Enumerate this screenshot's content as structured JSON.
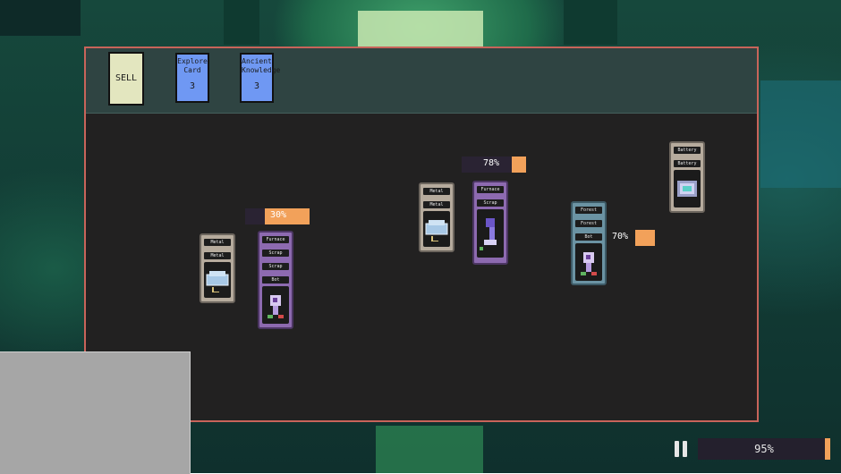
{
  "shelf": {
    "sell_label": "SELL",
    "packs": [
      {
        "title_line1": "Explore",
        "title_line2": "Card",
        "count": "3"
      },
      {
        "title_line1": "Ancient",
        "title_line2": "Knowledge",
        "count": "3"
      }
    ]
  },
  "stacks": [
    {
      "tabs": [
        "Metal",
        "Metal"
      ],
      "color": "gray",
      "icon": "metal-block-icon"
    },
    {
      "tabs": [
        "Furnace",
        "Scrap",
        "Scrap",
        "Bot"
      ],
      "color": "purple",
      "icon": "bot-icon",
      "progress_label": "30%",
      "progress": 0.3
    },
    {
      "tabs": [
        "Metal",
        "Metal"
      ],
      "color": "gray",
      "icon": "metal-block-icon"
    },
    {
      "tabs": [
        "Furnace",
        "Scrap"
      ],
      "color": "purple",
      "icon": "robot-arm-icon",
      "progress_label": "78%",
      "progress": 0.78
    },
    {
      "tabs": [
        "Forest",
        "Forest",
        "Bot"
      ],
      "color": "teal",
      "icon": "bot-icon",
      "progress_label": "70%",
      "progress": 0.7
    },
    {
      "tabs": [
        "Battery",
        "Battery"
      ],
      "color": "gray",
      "icon": "battery-icon"
    }
  ],
  "hud": {
    "pause_icon": "pause-icon",
    "overall_progress_label": "95%",
    "overall_progress": 0.95
  },
  "colors": {
    "panel_border": "#c8645a",
    "progress_fill": "#f2a15a",
    "pack_blue": "#6f98f3",
    "sell_card": "#e3e6bf"
  }
}
